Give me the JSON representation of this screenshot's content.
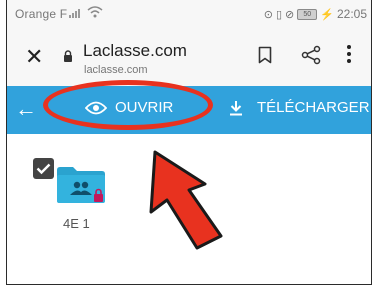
{
  "status_bar": {
    "carrier": "Orange F",
    "battery": "50",
    "time": "22:05"
  },
  "browser": {
    "site_title": "Laclasse.com",
    "site_url": "laclasse.com"
  },
  "toolbar": {
    "open_label": "OUVRIR",
    "download_label": "TÉLÉCHARGER ZIP",
    "color": "#31a2dc"
  },
  "folder": {
    "name": "4E 1",
    "checked": true,
    "icon": "shared-folder-icon",
    "color": "#2aa3cf"
  },
  "annotations": {
    "ellipse_color": "#e8321f",
    "arrow_color": "#e8321f"
  }
}
